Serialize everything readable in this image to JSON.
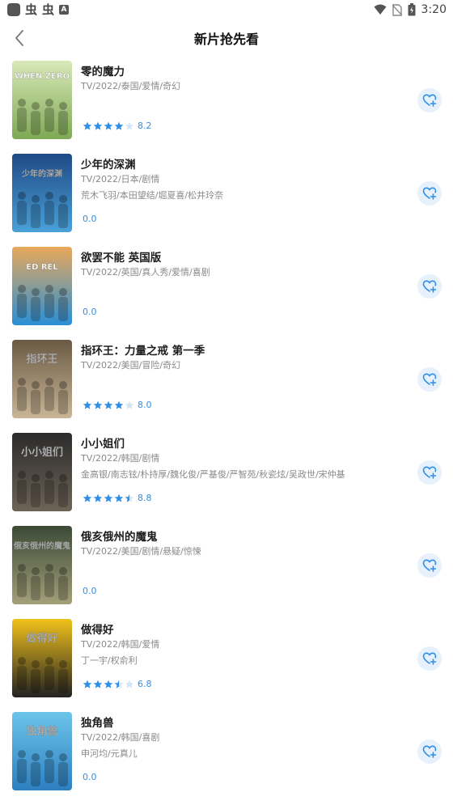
{
  "status_bar": {
    "time": "3:20",
    "left_icons": [
      "app-icon",
      "notification-icon",
      "notification-icon",
      "a-icon"
    ],
    "right_icons": [
      "wifi-icon",
      "no-sim-icon",
      "battery-icon"
    ]
  },
  "header": {
    "title": "新片抢先看",
    "back_icon": "chevron-left-icon"
  },
  "colors": {
    "star": "#2f8fe8",
    "star_empty": "#d3e6f8",
    "fav_bg": "#e6f1fc",
    "meta_text": "#8a8a8a"
  },
  "items": [
    {
      "title": "零的魔力",
      "meta": "TV/2022/泰国/爱情/奇幻",
      "cast": "",
      "rating_stars": 4,
      "score": "8.2",
      "poster_text": "WHEN ZERO",
      "poster_colors": [
        "#d9e8b8",
        "#7ea954"
      ]
    },
    {
      "title": "少年的深渊",
      "meta": "TV/2022/日本/剧情",
      "cast": "荒木飞羽/本田望结/堀夏喜/松井玲奈",
      "rating_stars": 0,
      "score": "0.0",
      "poster_text": "少年的深渊",
      "poster_colors": [
        "#1f4a86",
        "#4aa1d8"
      ]
    },
    {
      "title": "欲罢不能 英国版",
      "meta": "TV/2022/英国/真人秀/爱情/喜剧",
      "cast": "",
      "rating_stars": 0,
      "score": "0.0",
      "poster_text": "ED REL",
      "poster_colors": [
        "#e8a85a",
        "#2a8fd6"
      ]
    },
    {
      "title": "指环王：力量之戒 第一季",
      "meta": "TV/2022/美国/冒险/奇幻",
      "cast": "",
      "rating_stars": 4,
      "score": "8.0",
      "poster_text": "指环王",
      "poster_colors": [
        "#6b5a44",
        "#c9b596"
      ]
    },
    {
      "title": "小小姐们",
      "meta": "TV/2022/韩国/剧情",
      "cast": "金高银/南志铉/朴持厚/魏化俊/严基俊/严智苑/秋瓷炫/吴政世/宋仲基",
      "rating_stars": 4.5,
      "score": "8.8",
      "poster_text": "小小姐们",
      "poster_colors": [
        "#2b2b2b",
        "#6e6458"
      ]
    },
    {
      "title": "俄亥俄州的魔鬼",
      "meta": "TV/2022/美国/剧情/悬疑/惊悚",
      "cast": "",
      "rating_stars": 0,
      "score": "0.0",
      "poster_text": "俄亥俄州的魔鬼",
      "poster_colors": [
        "#3b4a36",
        "#a4a07a"
      ]
    },
    {
      "title": "做得好",
      "meta": "TV/2022/韩国/爱情",
      "cast": "丁一宇/权俞利",
      "rating_stars": 3.5,
      "score": "6.8",
      "poster_text": "做得好",
      "poster_colors": [
        "#f2c21b",
        "#222222"
      ]
    },
    {
      "title": "独角兽",
      "meta": "TV/2022/韩国/喜剧",
      "cast": "申河均/元真儿",
      "rating_stars": 0,
      "score": "0.0",
      "poster_text": "独角兽",
      "poster_colors": [
        "#6cc5ea",
        "#2d7fc0"
      ]
    }
  ]
}
